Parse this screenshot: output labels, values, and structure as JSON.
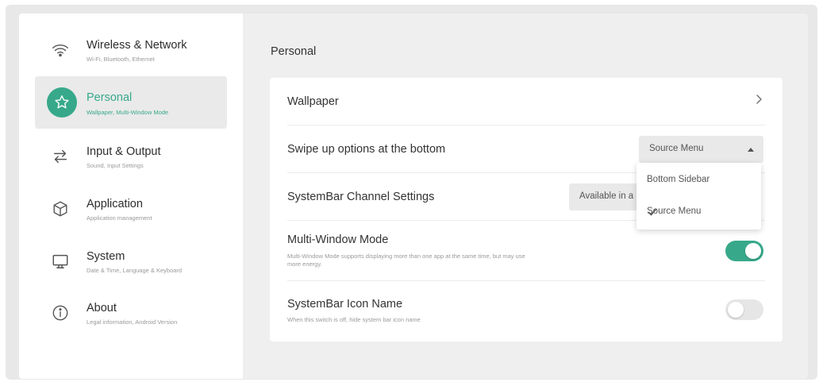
{
  "sidebar": {
    "items": [
      {
        "title": "Wireless & Network",
        "subtitle": "Wi-Fi, Bluetooth, Ethernet",
        "icon": "wifi-icon"
      },
      {
        "title": "Personal",
        "subtitle": "Wallpaper, Multi-Window Mode",
        "icon": "star-icon"
      },
      {
        "title": "Input & Output",
        "subtitle": "Sound, Input Settings",
        "icon": "swap-arrows-icon"
      },
      {
        "title": "Application",
        "subtitle": "Application management",
        "icon": "cube-icon"
      },
      {
        "title": "System",
        "subtitle": "Date & Time, Language & Keyboard",
        "icon": "monitor-icon"
      },
      {
        "title": "About",
        "subtitle": "Legal information, Android Version",
        "icon": "info-icon"
      }
    ],
    "active_index": 1
  },
  "main": {
    "title": "Personal",
    "rows": {
      "wallpaper": {
        "label": "Wallpaper"
      },
      "swipe": {
        "label": "Swipe up options at the bottom",
        "value": "Source Menu"
      },
      "systembar_channel": {
        "label": "SystemBar Channel Settings",
        "value": "Available in a"
      },
      "multi_window": {
        "label": "Multi-Window Mode",
        "description": "Multi-Window Mode supports displaying more than one app at the same time, but may use more energy.",
        "enabled": true
      },
      "systembar_icon": {
        "label": "SystemBar Icon Name",
        "description": "When this switch is off, hide system bar icon name",
        "enabled": false
      }
    }
  },
  "dropdown": {
    "options": [
      "Bottom Sidebar",
      "Source Menu"
    ],
    "selected": "Source Menu"
  },
  "colors": {
    "accent": "#37a98a",
    "card": "#ffffff",
    "background": "#efefef"
  }
}
